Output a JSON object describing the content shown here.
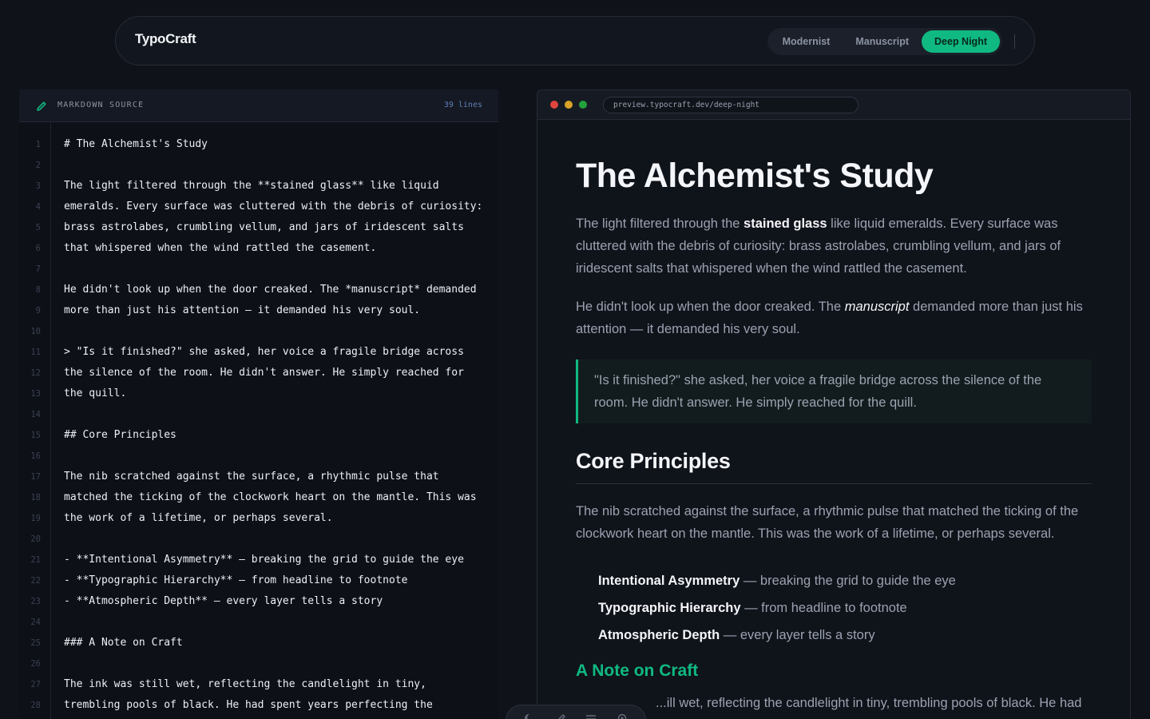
{
  "app": {
    "brand": "TypoCraft",
    "themes": [
      {
        "label": "Modernist",
        "active": false
      },
      {
        "label": "Manuscript",
        "active": false
      },
      {
        "label": "Deep Night",
        "active": true
      }
    ],
    "colors": {
      "accent": "#10b981",
      "background": "#0f1219"
    }
  },
  "source": {
    "title": "MARKDOWN SOURCE",
    "line_count": "39 lines",
    "icon": "pencil-icon",
    "lines": [
      {
        "n": "1",
        "text": "# The Alchemist's Study"
      },
      {
        "n": "2",
        "text": ""
      },
      {
        "n": "3",
        "text": "The light filtered through the **stained glass** like liquid"
      },
      {
        "n": "4",
        "text": "emeralds. Every surface was cluttered with the debris of curiosity:"
      },
      {
        "n": "5",
        "text": "brass astrolabes, crumbling vellum, and jars of iridescent salts"
      },
      {
        "n": "6",
        "text": "that whispered when the wind rattled the casement."
      },
      {
        "n": "7",
        "text": ""
      },
      {
        "n": "8",
        "text": "He didn't look up when the door creaked. The *manuscript* demanded"
      },
      {
        "n": "9",
        "text": "more than just his attention — it demanded his very soul."
      },
      {
        "n": "10",
        "text": ""
      },
      {
        "n": "11",
        "text": "> \"Is it finished?\" she asked, her voice a fragile bridge across"
      },
      {
        "n": "12",
        "text": "the silence of the room. He didn't answer. He simply reached for"
      },
      {
        "n": "13",
        "text": "the quill."
      },
      {
        "n": "14",
        "text": ""
      },
      {
        "n": "15",
        "text": "## Core Principles"
      },
      {
        "n": "16",
        "text": ""
      },
      {
        "n": "17",
        "text": "The nib scratched against the surface, a rhythmic pulse that"
      },
      {
        "n": "18",
        "text": "matched the ticking of the clockwork heart on the mantle. This was"
      },
      {
        "n": "19",
        "text": "the work of a lifetime, or perhaps several."
      },
      {
        "n": "20",
        "text": ""
      },
      {
        "n": "21",
        "text": "- **Intentional Asymmetry** — breaking the grid to guide the eye"
      },
      {
        "n": "22",
        "text": "- **Typographic Hierarchy** — from headline to footnote"
      },
      {
        "n": "23",
        "text": "- **Atmospheric Depth** — every layer tells a story"
      },
      {
        "n": "24",
        "text": ""
      },
      {
        "n": "25",
        "text": "### A Note on Craft"
      },
      {
        "n": "26",
        "text": ""
      },
      {
        "n": "27",
        "text": "The ink was still wet, reflecting the candlelight in tiny,"
      },
      {
        "n": "28",
        "text": "trembling pools of black. He had spent years perfecting the"
      }
    ]
  },
  "preview": {
    "url": "preview.typocraft.dev/deep-night",
    "dot_colors": [
      "#e0443e",
      "#d8a326",
      "#23a03b"
    ],
    "h1": "The Alchemist's Study",
    "p1": {
      "a": "The light filtered through the ",
      "strong": "stained glass",
      "b": " like liquid emeralds. Every surface was cluttered with the debris of curiosity: brass astrolabes, crumbling vellum, and jars of iridescent salts that whispered when the wind rattled the casement."
    },
    "p2": {
      "a": "He didn't look up when the door creaked. The ",
      "em": "manuscript",
      "b": " demanded more than just his attention — it demanded his very soul."
    },
    "quote": "\"Is it finished?\" she asked, her voice a fragile bridge across the silence of the room. He didn't answer. He simply reached for the quill.",
    "h2": "Core Principles",
    "p3": "The nib scratched against the surface, a rhythmic pulse that matched the ticking of the clockwork heart on the mantle. This was the work of a lifetime, or perhaps several.",
    "list": [
      {
        "strong": "Intentional Asymmetry",
        "rest": " — breaking the grid to guide the eye"
      },
      {
        "strong": "Typographic Hierarchy",
        "rest": " — from headline to footnote"
      },
      {
        "strong": "Atmospheric Depth",
        "rest": " — every layer tells a story"
      }
    ],
    "h3": "A Note on Craft",
    "p4_partial": "...ill wet, reflecting the candlelight in tiny, trembling pools of black. He had"
  },
  "toolbar": {
    "icons": [
      "moon-icon",
      "brush-icon",
      "menu-icon",
      "settings-icon"
    ]
  }
}
